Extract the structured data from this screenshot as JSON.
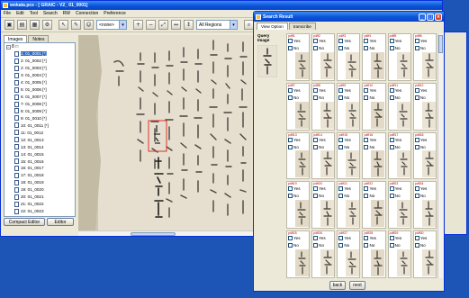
{
  "window": {
    "title": "wokata.pcs - [ GRAIC - V2_ 01_0001]"
  },
  "menu": [
    "File",
    "Edit",
    "Tool",
    "Search",
    "RW",
    "Connection",
    "Preference"
  ],
  "toolbar": {
    "model_select": "<none>",
    "region_select": "All Regions"
  },
  "left_panel": {
    "tabs": [
      "Images",
      "Notes"
    ],
    "root_label": "8 □",
    "items": [
      "1: 01_0001 [*]",
      "2: 01_0002 [*]",
      "2: 01_0003 [*]",
      "3: 01_0004 [*]",
      "4: 01_0005 [*]",
      "5: 01_0006 [*]",
      "6: 01_0007 [*]",
      "7: 01_0008 [*]",
      "8: 01_0009 [*]",
      "9: 01_0010 [*]",
      "10: 01_0011 [*]",
      "11: 01_0012",
      "12: 01_0013",
      "13: 01_0014",
      "14: 01_0015",
      "15: 01_0016",
      "16: 01_0017",
      "17: 01_0018",
      "18: 01_0019",
      "19: 01_0020",
      "20: 01_0021",
      "21: 01_0022",
      "22: 01_0023",
      "23: 01_0024",
      "24: 01_0025"
    ],
    "compact_editor": "Compact Editor",
    "editor": "Editor"
  },
  "right_strip_label": "ight A",
  "dialog": {
    "title": "Search Result",
    "tabs": [
      "View Option",
      "transcribe"
    ],
    "query_label": "Query Image",
    "yes": "Yes",
    "no": "No",
    "back": "back",
    "next": "next",
    "results": [
      "pdff1",
      "pdff2",
      "pdff3",
      "pdff4",
      "pdff5",
      "pdff6",
      "pdff7",
      "pdff8",
      "pdff9",
      "pdff10",
      "pdff11",
      "pdff12",
      "pdff13",
      "pdff14",
      "pdff15",
      "pdff16",
      "pdff17",
      "pdff18",
      "pdff19",
      "pdff20",
      "pdff21",
      "pdff22",
      "pdff23",
      "pdff24",
      "pdff25",
      "pdff26",
      "pdff27",
      "pdff28",
      "pdff29",
      "pdff30"
    ]
  }
}
